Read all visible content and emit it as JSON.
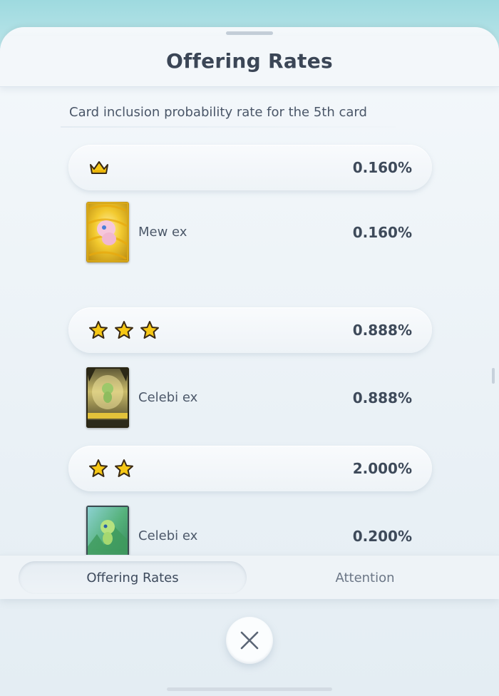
{
  "header": {
    "title": "Offering Rates"
  },
  "subtitle": "Card inclusion probability rate for the 5th card",
  "rows": [
    {
      "kind": "tier",
      "icon": "crown-icon",
      "rate": "0.160%"
    },
    {
      "kind": "card",
      "name": "Mew ex",
      "rate": "0.160%",
      "art": "mew-ex-card-art"
    },
    {
      "kind": "tier",
      "icon": "three-star-icon",
      "rate": "0.888%"
    },
    {
      "kind": "card",
      "name": "Celebi ex",
      "rate": "0.888%",
      "art": "celebi-ex-immersive-card-art"
    },
    {
      "kind": "tier",
      "icon": "two-star-icon",
      "rate": "2.000%"
    },
    {
      "kind": "card",
      "name": "Celebi ex",
      "rate": "0.200%",
      "art": "celebi-ex-full-art-card-art"
    }
  ],
  "tabs": [
    {
      "label": "Offering Rates",
      "active": true
    },
    {
      "label": "Attention",
      "active": false
    }
  ],
  "colors": {
    "star_fill": "#f7c815",
    "star_outline": "#3a2a14",
    "sheet_bg": "#eef3f7",
    "text": "#3d4a5c"
  }
}
